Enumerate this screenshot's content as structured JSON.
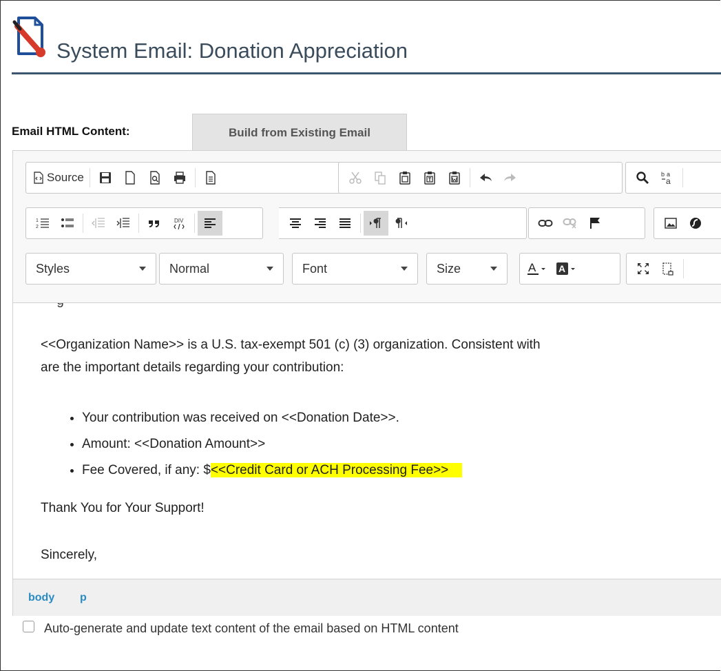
{
  "page": {
    "title": "System Email: Donation Appreciation"
  },
  "form": {
    "content_label": "Email HTML Content:",
    "build_button": "Build from Existing Email"
  },
  "toolbar": {
    "source_label": "Source",
    "combos": {
      "styles": "Styles",
      "format": "Normal",
      "font": "Font",
      "size": "Size"
    }
  },
  "content": {
    "paragraph1_line1": "<<Organization Name>> is a U.S. tax-exempt 501 (c) (3) organization. Consistent with",
    "paragraph1_line2": "are the important details regarding your contribution:",
    "bullets": [
      "Your contribution was received on <<Donation Date>>.",
      "Amount: <<Donation Amount>>",
      "Fee Covered, if any: $"
    ],
    "highlight": "<<Credit Card or ACH Processing Fee>>",
    "thanks": "Thank You for Your Support!",
    "closing": "Sincerely,"
  },
  "statusbar": {
    "path": [
      "body",
      "p"
    ]
  },
  "options": {
    "auto_generate_label": "Auto-generate and update text content of the email based on HTML content",
    "auto_generate_checked": false
  },
  "colors": {
    "highlight": "#ffff00",
    "title_rule": "#3c566d",
    "path_link": "#2a8bc2"
  }
}
